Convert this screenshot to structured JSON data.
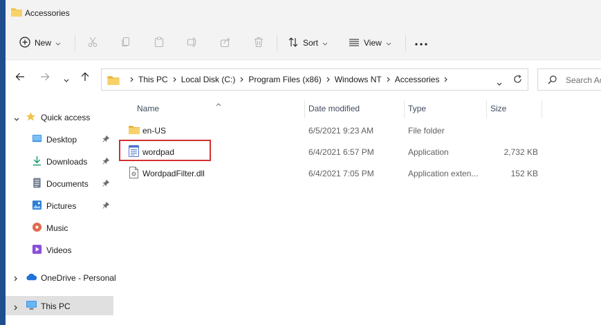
{
  "window": {
    "title": "Accessories"
  },
  "toolbar": {
    "new_label": "New",
    "sort_label": "Sort",
    "view_label": "View"
  },
  "breadcrumbs": [
    "This PC",
    "Local Disk (C:)",
    "Program Files (x86)",
    "Windows NT",
    "Accessories"
  ],
  "search": {
    "placeholder": "Search Ac"
  },
  "sidebar": {
    "items": [
      {
        "label": "Quick access"
      },
      {
        "label": "Desktop"
      },
      {
        "label": "Downloads"
      },
      {
        "label": "Documents"
      },
      {
        "label": "Pictures"
      },
      {
        "label": "Music"
      },
      {
        "label": "Videos"
      },
      {
        "label": "OneDrive - Personal"
      },
      {
        "label": "This PC"
      }
    ]
  },
  "columns": {
    "name": "Name",
    "date": "Date modified",
    "type": "Type",
    "size": "Size"
  },
  "files": [
    {
      "name": "en-US",
      "date": "6/5/2021 9:23 AM",
      "type": "File folder",
      "size": "",
      "icon": "folder-icon"
    },
    {
      "name": "wordpad",
      "date": "6/4/2021 6:57 PM",
      "type": "Application",
      "size": "2,732 KB",
      "icon": "wordpad-app-icon"
    },
    {
      "name": "WordpadFilter.dll",
      "date": "6/4/2021 7:05 PM",
      "type": "Application exten...",
      "size": "152 KB",
      "icon": "dll-file-icon"
    }
  ],
  "colors": {
    "accent": "#0067c0",
    "folder": "#f2c14e",
    "highlight": "#d32f2f",
    "selected": "#e0e0e0"
  }
}
